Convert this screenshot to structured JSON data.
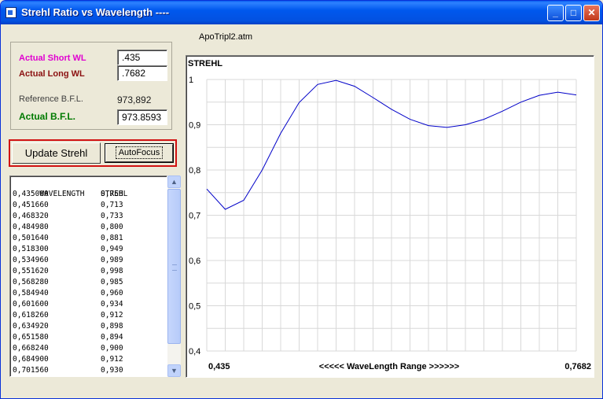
{
  "window": {
    "title": "Strehl Ratio vs Wavelength  ----",
    "controls": {
      "minimize": "_",
      "maximize": "□",
      "close": "✕"
    }
  },
  "document_name": "ApoTripl2.atm",
  "wavelength_panel": {
    "short_label": "Actual Short WL",
    "short_value": ".435",
    "long_label": "Actual Long WL",
    "long_value": ".7682",
    "reference_bfl_label": "Reference   B.F.L.",
    "reference_bfl_value": "973,892",
    "actual_bfl_label": "Actual    B.F.L.",
    "actual_bfl_value": "973.8593"
  },
  "buttons": {
    "update_strehl": "Update Strehl",
    "autofocus": "AutoFocus"
  },
  "table": {
    "headers": [
      "WAVELENGTH",
      "STREHL"
    ],
    "rows": [
      [
        "0,435000",
        "0,758"
      ],
      [
        "0,451660",
        "0,713"
      ],
      [
        "0,468320",
        "0,733"
      ],
      [
        "0,484980",
        "0,800"
      ],
      [
        "0,501640",
        "0,881"
      ],
      [
        "0,518300",
        "0,949"
      ],
      [
        "0,534960",
        "0,989"
      ],
      [
        "0,551620",
        "0,998"
      ],
      [
        "0,568280",
        "0,985"
      ],
      [
        "0,584940",
        "0,960"
      ],
      [
        "0,601600",
        "0,934"
      ],
      [
        "0,618260",
        "0,912"
      ],
      [
        "0,634920",
        "0,898"
      ],
      [
        "0,651580",
        "0,894"
      ],
      [
        "0,668240",
        "0,900"
      ],
      [
        "0,684900",
        "0,912"
      ],
      [
        "0,701560",
        "0,930"
      ]
    ]
  },
  "scrollbar": {
    "up_icon": "scroll-up-arrow",
    "down_icon": "scroll-down-arrow"
  },
  "chart_data": {
    "type": "line",
    "title": "STREHL",
    "xlabel": "<<<<<  WaveLength Range  >>>>>>",
    "x_min_label": "0,435",
    "x_max_label": "0,7682",
    "y_tick_labels": [
      "1",
      "0,9",
      "0,8",
      "0,7",
      "0,6",
      "0,5",
      "0,4"
    ],
    "ylim": [
      0.4,
      1.0
    ],
    "xlim": [
      0.435,
      0.7682
    ],
    "grid": true,
    "line_color": "#0000c8",
    "x": [
      0.435,
      0.45166,
      0.46832,
      0.48498,
      0.50164,
      0.5183,
      0.53496,
      0.55162,
      0.56828,
      0.58494,
      0.6016,
      0.61826,
      0.63492,
      0.65158,
      0.66824,
      0.6849,
      0.70156,
      0.71822,
      0.73488,
      0.75154,
      0.7682
    ],
    "y": [
      0.758,
      0.713,
      0.733,
      0.8,
      0.881,
      0.949,
      0.989,
      0.998,
      0.985,
      0.96,
      0.934,
      0.912,
      0.898,
      0.894,
      0.9,
      0.912,
      0.93,
      0.95,
      0.965,
      0.972,
      0.966
    ]
  }
}
